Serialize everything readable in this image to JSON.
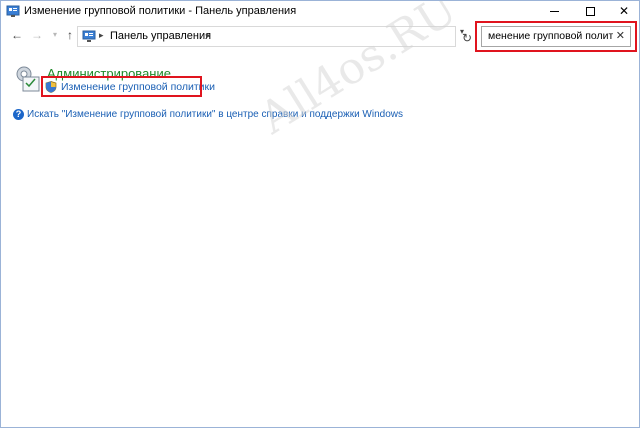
{
  "window": {
    "title": "Изменение групповой политики - Панель управления",
    "controls": {
      "minimize_icon": "minimize-icon",
      "maximize_icon": "maximize-icon",
      "close_glyph": "✕"
    }
  },
  "navigation": {
    "back_glyph": "←",
    "forward_glyph": "→",
    "history_glyph": "▾",
    "up_glyph": "↑",
    "address": {
      "separator": "▸",
      "breadcrumb": "Панель управления",
      "dropdown_glyph": "▾"
    },
    "refresh_glyph": "↻",
    "search": {
      "value": "менение групповой политики",
      "clear_glyph": "✕"
    }
  },
  "content": {
    "category": {
      "title": "Администрирование",
      "icon": "admin-tools-icon"
    },
    "task": {
      "label": "Изменение групповой политики",
      "icon": "shield-icon"
    },
    "help": {
      "glyph": "?",
      "text": "Искать \"Изменение групповой политики\" в центре справки и поддержки Windows"
    },
    "watermark": "All4os.RU"
  },
  "colors": {
    "highlight": "#e0141e",
    "link": "#1a5fb4",
    "category": "#1e8a2a",
    "border": "#9bb3d7"
  }
}
